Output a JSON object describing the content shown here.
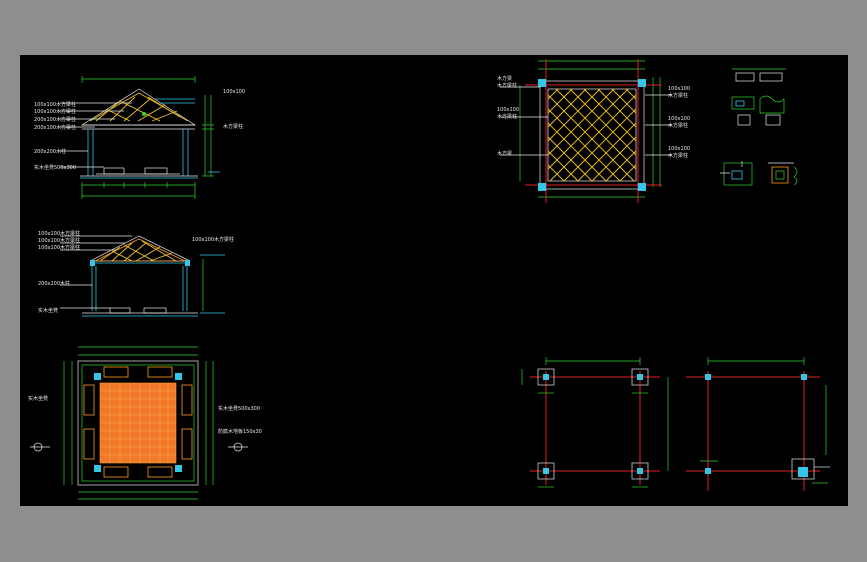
{
  "colors": {
    "window_bg": "#8e8e8e",
    "canvas_bg": "#000000",
    "dimension": "#2cd62c",
    "outline": "#e8e8e8",
    "column": "#33c6e8",
    "beam": "#f0c020",
    "floor": "#ff9a20",
    "axis": "#e02020"
  },
  "labels": {
    "elev1": {
      "roof1": "100x100木方梁柱",
      "roof2": "100x100木方梁柱",
      "roof3": "200x100木方梁柱",
      "roof4": "200x100木方梁柱",
      "col": "200x200木柱",
      "seat": "实木坐凳500x300",
      "r1": "100x100",
      "r2": "木方梁柱"
    },
    "elev2": {
      "roof1": "100x100木方梁柱",
      "roof2": "100x100木方梁柱",
      "roof3": "100x100木方梁柱",
      "right": "100x100木方梁柱",
      "col": "200x200木柱",
      "seat": "实木坐凳"
    },
    "roofplan": {
      "l1": "木方梁",
      "l2": "木方梁柱",
      "l3": "100x100",
      "l4": "木方梁柱",
      "l5": "木方梁",
      "r1": "100x100",
      "r2": "木方梁柱",
      "r3": "100x100",
      "r4": "木方梁柱",
      "r5": "100x100",
      "r6": "木方梁柱"
    },
    "floorplan": {
      "left": "实木坐凳",
      "r1": "实木坐凳500x300",
      "r2": "防腐木地板150x30"
    }
  }
}
